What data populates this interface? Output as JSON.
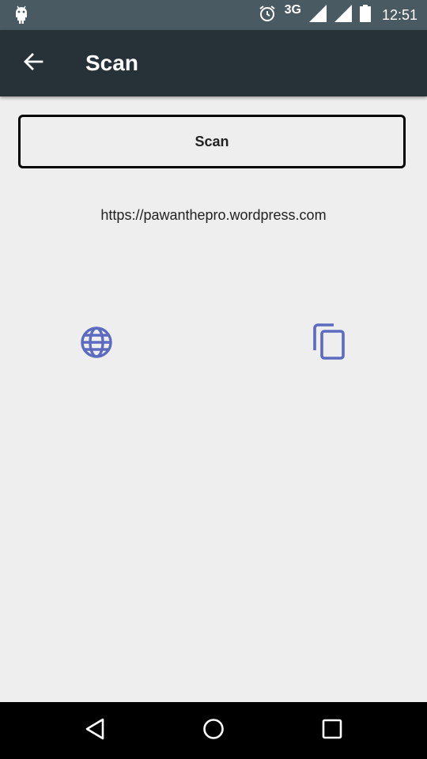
{
  "status_bar": {
    "network": "3G",
    "time": "12:51",
    "icons": [
      "android-icon",
      "alarm-icon",
      "signal-icon",
      "signal-icon",
      "battery-icon"
    ]
  },
  "app_bar": {
    "title": "Scan",
    "back_icon": "arrow-back-icon"
  },
  "main": {
    "scan_button_label": "Scan",
    "result_url": "https://pawanthepro.wordpress.com",
    "actions": [
      {
        "name": "open-in-browser",
        "icon": "globe-icon"
      },
      {
        "name": "copy-to-clipboard",
        "icon": "copy-icon"
      }
    ]
  },
  "nav_bar": {
    "icons": [
      "back-triangle-icon",
      "home-circle-icon",
      "recents-square-icon"
    ]
  },
  "colors": {
    "status_bar": "#4a5a63",
    "app_bar": "#263238",
    "background": "#eeeeee",
    "accent_icon": "#5c6bc0",
    "nav_bar": "#000000"
  }
}
